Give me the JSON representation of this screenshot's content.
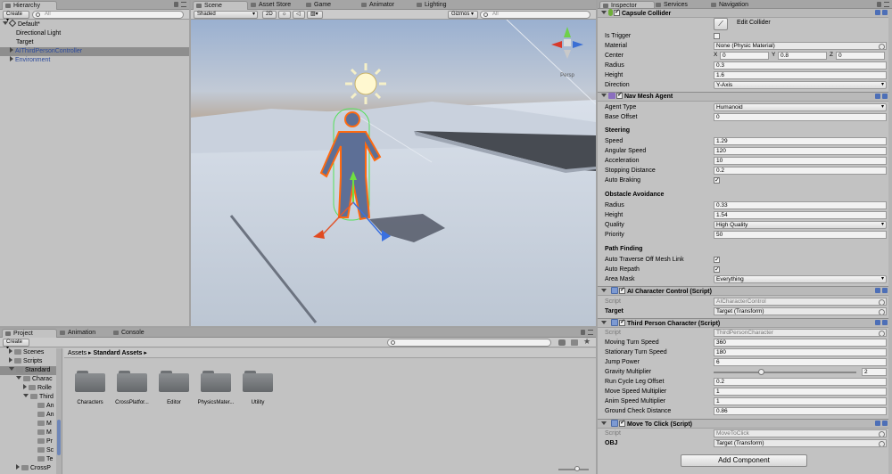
{
  "hierarchy": {
    "tab": "Hierarchy",
    "create": "Create",
    "search_placeholder": "All",
    "scene_name": "Default*",
    "items": [
      "Directional Light",
      "Target",
      "AIThirdPersonController",
      "Environment"
    ]
  },
  "scene": {
    "tabs": [
      "Scene",
      "Asset Store",
      "Game",
      "Animator",
      "Lighting"
    ],
    "shading": "Shaded",
    "mode_2d": "2D",
    "gizmos": "Gizmos",
    "search_placeholder": "All",
    "persp": "Persp"
  },
  "inspector": {
    "tabs": [
      "Inspector",
      "Services",
      "Navigation"
    ],
    "capsule": {
      "title": "Capsule Collider",
      "edit": "Edit Collider",
      "is_trigger": "Is Trigger",
      "material_label": "Material",
      "material": "None (Physic Material)",
      "center_label": "Center",
      "center": {
        "x": "0",
        "y": "0.8",
        "z": "0"
      },
      "radius_label": "Radius",
      "radius": "0.3",
      "height_label": "Height",
      "height": "1.6",
      "direction_label": "Direction",
      "direction": "Y-Axis"
    },
    "nav": {
      "title": "Nav Mesh Agent",
      "agent_type_label": "Agent Type",
      "agent_type": "Humanoid",
      "base_offset_label": "Base Offset",
      "base_offset": "0",
      "steering": "Steering",
      "speed_label": "Speed",
      "speed": "1.29",
      "angular_label": "Angular Speed",
      "angular": "120",
      "accel_label": "Acceleration",
      "accel": "10",
      "stop_label": "Stopping Distance",
      "stop": "0.2",
      "auto_brake_label": "Auto Braking",
      "obstacle": "Obstacle Avoidance",
      "oradius_label": "Radius",
      "oradius": "0.33",
      "oheight_label": "Height",
      "oheight": "1.54",
      "quality_label": "Quality",
      "quality": "High Quality",
      "priority_label": "Priority",
      "priority": "50",
      "path": "Path Finding",
      "traverse_label": "Auto Traverse Off Mesh Link",
      "repath_label": "Auto Repath",
      "area_label": "Area Mask",
      "area": "Everything"
    },
    "aic": {
      "title": "AI Character Control (Script)",
      "script_label": "Script",
      "script": "AICharacterControl",
      "target_label": "Target",
      "target": "Target (Transform)"
    },
    "tpc": {
      "title": "Third Person Character (Script)",
      "script_label": "Script",
      "script": "ThirdPersonCharacter",
      "moving_label": "Moving Turn Speed",
      "moving": "360",
      "stationary_label": "Stationary Turn Speed",
      "stationary": "180",
      "jump_label": "Jump Power",
      "jump": "6",
      "gravity_label": "Gravity Multiplier",
      "gravity": "2",
      "runcycle_label": "Run Cycle Leg Offset",
      "runcycle": "0.2",
      "movespeed_label": "Move Speed Multiplier",
      "movespeed": "1",
      "anim_label": "Anim Speed Multiplier",
      "anim": "1",
      "ground_label": "Ground Check Distance",
      "ground": "0.86"
    },
    "mtc": {
      "title": "Move To Click (Script)",
      "script_label": "Script",
      "script": "MoveToClick",
      "obj_label": "OBJ",
      "obj": "Target (Transform)"
    },
    "add_component": "Add Component"
  },
  "project": {
    "tabs": [
      "Project",
      "Animation",
      "Console"
    ],
    "create": "Create",
    "tree": [
      "Scenes",
      "Scripts",
      "Standard",
      "Charac",
      "Rolle",
      "Third",
      "An",
      "An",
      "M",
      "M",
      "Pr",
      "Sc",
      "Te",
      "CrossP"
    ],
    "breadcrumb": [
      "Assets",
      "Standard Assets"
    ],
    "folders": [
      "Characters",
      "CrossPlatfor...",
      "Editor",
      "PhysicsMater...",
      "Utility"
    ]
  }
}
